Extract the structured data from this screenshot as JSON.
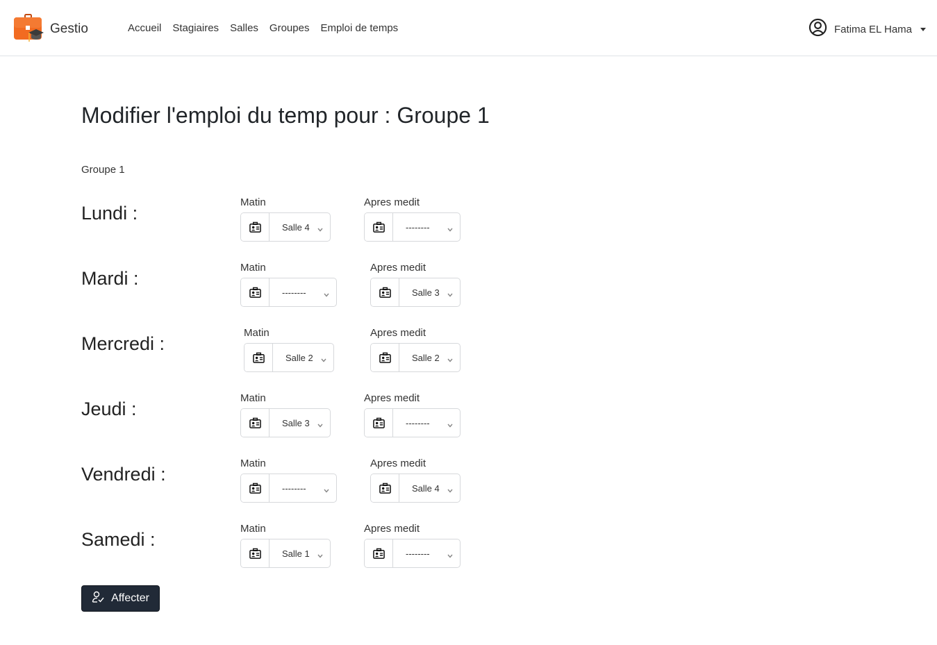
{
  "navbar": {
    "brand": "Gestio",
    "links": [
      "Accueil",
      "Stagiaires",
      "Salles",
      "Groupes",
      "Emploi de temps"
    ],
    "user_name": "Fatima EL Hama"
  },
  "page": {
    "title": "Modifier l'emploi du temp pour : Groupe 1",
    "group_name": "Groupe 1"
  },
  "labels": {
    "matin": "Matin",
    "apres": "Apres medit"
  },
  "days": [
    {
      "label": "Lundi :",
      "matin": "Salle 4",
      "apres": "--------"
    },
    {
      "label": "Mardi :",
      "matin": "--------",
      "apres": "Salle 3"
    },
    {
      "label": "Mercredi :",
      "matin": "Salle 2",
      "apres": "Salle 2"
    },
    {
      "label": "Jeudi :",
      "matin": "Salle 3",
      "apres": "--------"
    },
    {
      "label": "Vendredi :",
      "matin": "--------",
      "apres": "Salle 4"
    },
    {
      "label": "Samedi :",
      "matin": "Salle 1",
      "apres": "--------"
    }
  ],
  "actions": {
    "submit_label": "Affecter"
  },
  "colors": {
    "button_bg": "#212a37",
    "logo_orange": "#f26b21",
    "border": "#dee2e6"
  }
}
